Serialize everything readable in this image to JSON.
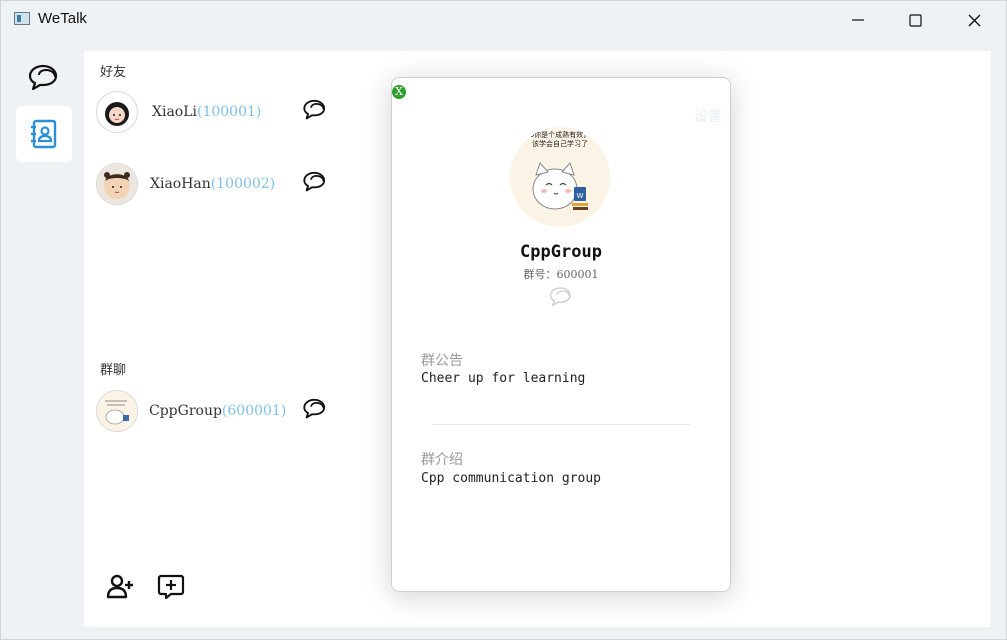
{
  "window": {
    "title": "WeTalk"
  },
  "rail": {
    "items": [
      {
        "icon": "chat-bubbles-icon",
        "active": false
      },
      {
        "icon": "contacts-book-icon",
        "active": true
      }
    ]
  },
  "friends": {
    "title": "好友",
    "items": [
      {
        "name": "XiaoLi",
        "id": "(100001)"
      },
      {
        "name": "XiaoHan",
        "id": "(100002)"
      }
    ]
  },
  "groups": {
    "title": "群聊",
    "items": [
      {
        "name": "CppGroup",
        "id": "(600001)"
      }
    ]
  },
  "bottom": {
    "icons": [
      "add-friend-icon",
      "add-group-icon"
    ]
  },
  "dialog": {
    "close_label": "X",
    "settings_label": "设置",
    "avatar_caption_line1": "o你是个成熟有效，",
    "avatar_caption_line2": "该学会自己学习了",
    "group_name": "CppGroup",
    "group_number": "群号：600001",
    "notice_label": "群公告",
    "notice_text": "Cheer up for learning",
    "intro_label": "群介绍",
    "intro_text": "Cpp communication group"
  },
  "colors": {
    "accent": "#2a8fd6",
    "id_color": "#7fbfe6",
    "close": "#2f9e2f"
  }
}
